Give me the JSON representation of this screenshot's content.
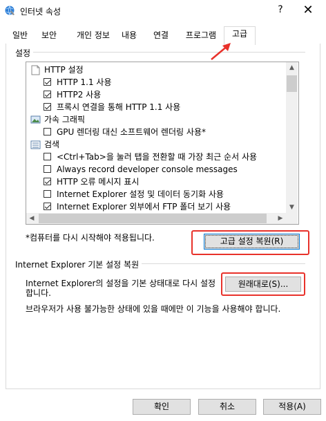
{
  "window": {
    "title": "인터넷 속성",
    "help": "?",
    "close": "✕"
  },
  "tabs": [
    "일반",
    "보안",
    "개인 정보",
    "내용",
    "연결",
    "프로그램",
    "고급"
  ],
  "settings_group": {
    "label": "설정",
    "items": [
      {
        "type": "header",
        "icon": "page-icon",
        "label": "HTTP 설정"
      },
      {
        "type": "checkbox",
        "checked": true,
        "label": "HTTP 1.1 사용"
      },
      {
        "type": "checkbox",
        "checked": true,
        "label": "HTTP2 사용"
      },
      {
        "type": "checkbox",
        "checked": true,
        "label": "프록시 연결을 통해 HTTP 1.1 사용"
      },
      {
        "type": "header",
        "icon": "accelerated-graphics-icon",
        "label": "가속 그래픽"
      },
      {
        "type": "checkbox",
        "checked": false,
        "label": "GPU 렌더링 대신 소프트웨어 렌더링 사용*"
      },
      {
        "type": "header",
        "icon": "search-list-icon",
        "label": "검색"
      },
      {
        "type": "checkbox",
        "checked": false,
        "label": "<Ctrl+Tab>을 눌러 탭을 전환할 때 가장 최근 순서 사용"
      },
      {
        "type": "checkbox",
        "checked": false,
        "label": "Always record developer console messages"
      },
      {
        "type": "checkbox",
        "checked": true,
        "label": "HTTP 오류 메시지 표시"
      },
      {
        "type": "checkbox",
        "checked": false,
        "label": "Internet Explorer 설정 및 데이터 동기화 사용"
      },
      {
        "type": "checkbox",
        "checked": true,
        "label": "Internet Explorer 외부에서 FTP 폴더 보기 사용"
      }
    ],
    "restart_note": "*컴퓨터를 다시 시작해야 적용됩니다.",
    "restore_advanced_button": "고급 설정 복원(R)"
  },
  "reset_group": {
    "label": "Internet Explorer 기본 설정 복원",
    "description_line1": "Internet Explorer의 설정을 기본 상태대로 다시 설정",
    "description_line2": "합니다.",
    "reset_button": "원래대로(S)...",
    "warning": "브라우저가 사용 불가능한 상태에 있을 때에만 이 기능을 사용해야 합니다."
  },
  "footer": {
    "ok": "확인",
    "cancel": "취소",
    "apply": "적용(A)"
  },
  "colors": {
    "annotation_red": "#e8312a",
    "focus_blue": "#0078d7",
    "button_face": "#e1e1e1"
  }
}
